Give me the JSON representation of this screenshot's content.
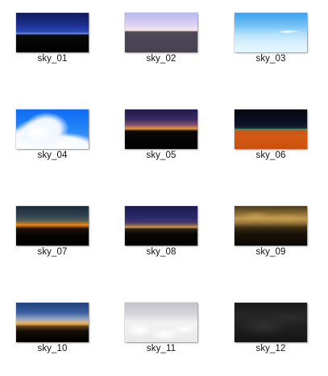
{
  "files": [
    {
      "name": "sky_01",
      "thumb": "sky_01-thumbnail"
    },
    {
      "name": "sky_02",
      "thumb": "sky_02-thumbnail"
    },
    {
      "name": "sky_03",
      "thumb": "sky_03-thumbnail"
    },
    {
      "name": "sky_04",
      "thumb": "sky_04-thumbnail"
    },
    {
      "name": "sky_05",
      "thumb": "sky_05-thumbnail"
    },
    {
      "name": "sky_06",
      "thumb": "sky_06-thumbnail"
    },
    {
      "name": "sky_07",
      "thumb": "sky_07-thumbnail"
    },
    {
      "name": "sky_08",
      "thumb": "sky_08-thumbnail"
    },
    {
      "name": "sky_09",
      "thumb": "sky_09-thumbnail"
    },
    {
      "name": "sky_10",
      "thumb": "sky_10-thumbnail"
    },
    {
      "name": "sky_11",
      "thumb": "sky_11-thumbnail"
    },
    {
      "name": "sky_12",
      "thumb": "sky_12-thumbnail"
    }
  ]
}
